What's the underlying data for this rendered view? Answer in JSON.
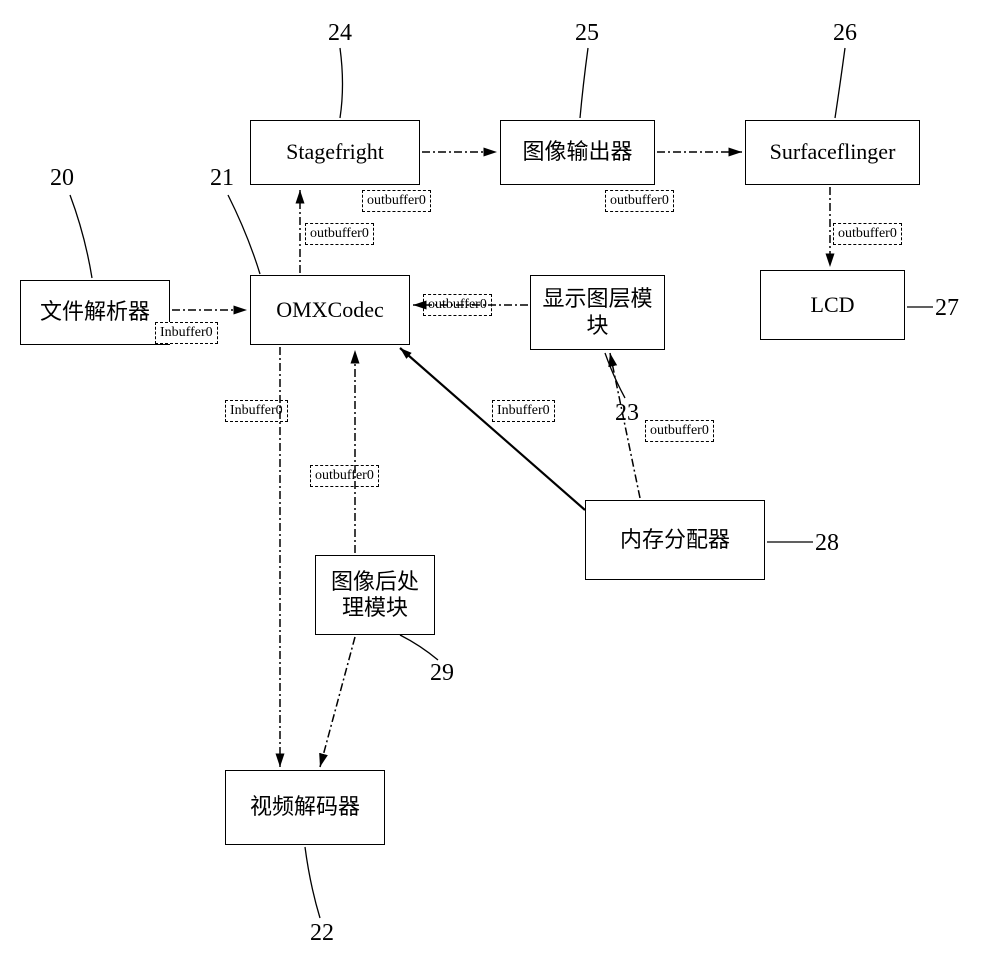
{
  "chart_data": {
    "type": "diagram",
    "nodes": [
      {
        "id": 20,
        "label": "文件解析器"
      },
      {
        "id": 21,
        "label": "OMXCodec"
      },
      {
        "id": 22,
        "label": "视频解码器"
      },
      {
        "id": 23,
        "label": "显示图层模块"
      },
      {
        "id": 24,
        "label": "Stagefright"
      },
      {
        "id": 25,
        "label": "图像输出器"
      },
      {
        "id": 26,
        "label": "Surfaceflinger"
      },
      {
        "id": 27,
        "label": "LCD"
      },
      {
        "id": 28,
        "label": "内存分配器"
      },
      {
        "id": 29,
        "label": "图像后处理模块"
      }
    ],
    "edges": [
      {
        "from": 20,
        "to": 21,
        "label": "Inbuffer0",
        "style": "dash-dot"
      },
      {
        "from": 21,
        "to": 22,
        "label": "Inbuffer0",
        "style": "dash-dot"
      },
      {
        "from": 29,
        "to": 21,
        "label": "outbuffer0",
        "style": "dash-dot"
      },
      {
        "from": 22,
        "to": 29,
        "label": "",
        "style": "dash-dot"
      },
      {
        "from": 23,
        "to": 21,
        "label": "outbuffer0",
        "style": "dash-dot"
      },
      {
        "from": 21,
        "to": 24,
        "label": "outbuffer0",
        "style": "dash-dot"
      },
      {
        "from": 24,
        "to": 25,
        "label": "outbuffer0",
        "style": "dash-dot"
      },
      {
        "from": 25,
        "to": 26,
        "label": "outbuffer0",
        "style": "dash-dot"
      },
      {
        "from": 26,
        "to": 27,
        "label": "outbuffer0",
        "style": "dash-dot"
      },
      {
        "from": 28,
        "to": 21,
        "label": "",
        "style": "solid"
      },
      {
        "from": 28,
        "to": 23,
        "label": "outbuffer0",
        "style": "dash-dot"
      },
      {
        "from": 28,
        "to": 23,
        "label": "Inbuffer0",
        "style": "split"
      }
    ]
  },
  "nodes": {
    "n20": "文件解析器",
    "n21": "OMXCodec",
    "n22": "视频解码器",
    "n23": "显示图层模\n块",
    "n24": "Stagefright",
    "n25": "图像输出器",
    "n26": "Surfaceflinger",
    "n27": "LCD",
    "n28": "内存分配器",
    "n29": "图像后处\n理模块"
  },
  "refs": {
    "r20": "20",
    "r21": "21",
    "r22": "22",
    "r23": "23",
    "r24": "24",
    "r25": "25",
    "r26": "26",
    "r27": "27",
    "r28": "28",
    "r29": "29"
  },
  "buffers": {
    "b1": "Inbuffer0",
    "b2": "Inbuffer0",
    "b3": "outbuffer0",
    "b4": "outbuffer0",
    "b5": "outbuffer0",
    "b6": "outbuffer0",
    "b7": "outbuffer0",
    "b8": "outbuffer0",
    "b9": "Inbuffer0",
    "b10": "outbuffer0"
  }
}
